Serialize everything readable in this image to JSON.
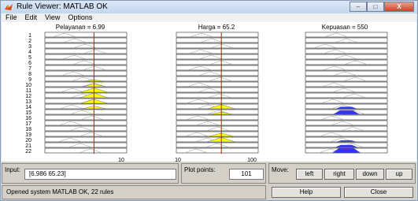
{
  "window": {
    "title": "Rule Viewer: MATLAB OK",
    "controls": {
      "minimize": "–",
      "maximize": "□",
      "close": "X"
    }
  },
  "menu": [
    "File",
    "Edit",
    "View",
    "Options"
  ],
  "columns": [
    {
      "label": "Pelayanan = 6.99",
      "range_end": "10",
      "red_line_fraction": 0.6,
      "shape_color": "#ffff00",
      "shape": "triangle"
    },
    {
      "label": "Harga = 65.2",
      "range_start": "10",
      "range_end": "100",
      "red_line_fraction": 0.55,
      "shape_color": "#ffff00",
      "shape": "triangle"
    },
    {
      "label": "Kepuasan = 550",
      "red_line_fraction": 0.5,
      "shape_color": "#3333ff",
      "shape": "trapezoid"
    }
  ],
  "rules": {
    "count": 22,
    "labels": [
      "1",
      "2",
      "3",
      "4",
      "5",
      "6",
      "7",
      "8",
      "9",
      "10",
      "11",
      "12",
      "13",
      "14",
      "15",
      "16",
      "17",
      "18",
      "19",
      "20",
      "21",
      "22"
    ],
    "col1_fill": [
      0,
      0,
      0,
      0,
      0,
      0,
      0,
      0,
      0.3,
      0.6,
      0.9,
      1,
      0.85,
      0.6,
      0,
      0,
      0,
      0,
      0,
      0,
      0,
      0
    ],
    "col2_fill": [
      0,
      0,
      0,
      0,
      0,
      0,
      0,
      0,
      0,
      0,
      0,
      0,
      0,
      0.9,
      0.5,
      0,
      0,
      0,
      0.7,
      0.95,
      0,
      0
    ],
    "col3_fill": [
      0,
      0,
      0,
      0,
      0,
      0,
      0,
      0,
      0,
      0,
      0,
      0,
      0,
      0.4,
      0.8,
      0,
      0,
      0,
      0,
      0.3,
      0.5,
      1
    ]
  },
  "input": {
    "label": "Input:",
    "value": "[6.986 65.23]"
  },
  "plot_points": {
    "label": "Plot points:",
    "value": "101"
  },
  "move": {
    "label": "Move:",
    "left": "left",
    "right": "right",
    "down": "down",
    "up": "up"
  },
  "status": "Opened system MATLAB OK, 22 rules",
  "buttons": {
    "help": "Help",
    "close": "Close"
  }
}
